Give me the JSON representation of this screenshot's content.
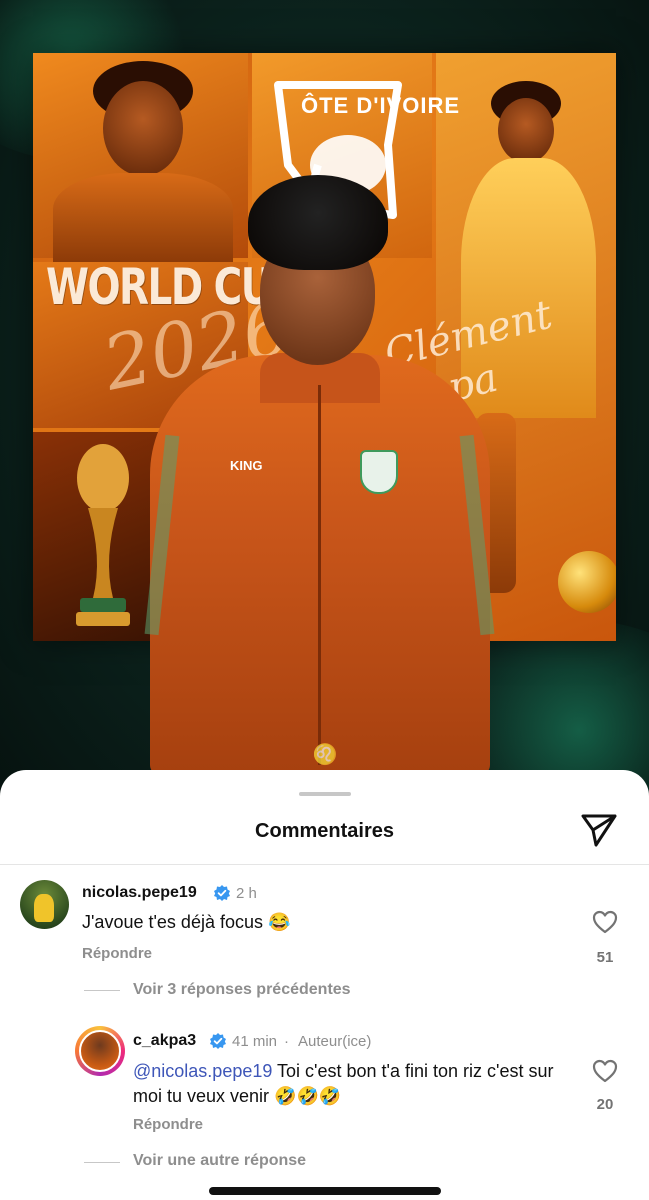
{
  "post": {
    "poster_headline": "WORLD CUP",
    "poster_year": "2026",
    "poster_signature": "Clément Akpa",
    "poster_badge_text": "ÔTE D'IVOIRE",
    "jacket_brand": "KING"
  },
  "sheet": {
    "title": "Commentaires"
  },
  "comments": [
    {
      "username": "nicolas.pepe19",
      "time": "2 h",
      "text": "J'avoue t'es déjà focus 😂",
      "reply_label": "Répondre",
      "likes": "51",
      "view_replies": "Voir 3 réponses précédentes"
    },
    {
      "username": "c_akpa3",
      "time": "41 min",
      "author_label": "Auteur(ice)",
      "mention": "@nicolas.pepe19",
      "text": " Toi c'est bon t'a fini ton riz c'est sur moi tu veux venir 🤣🤣🤣",
      "reply_label": "Répondre",
      "likes": "20",
      "view_replies": "Voir une autre réponse"
    }
  ],
  "icons": {
    "share": "paper-plane-icon",
    "like": "heart-outline-icon",
    "verified": "verified-badge-icon"
  },
  "colors": {
    "accent_orange": "#e06a1d",
    "mention_blue": "#3e56b8",
    "verified_blue": "#3897f0",
    "muted_text": "#8e8e8e"
  }
}
